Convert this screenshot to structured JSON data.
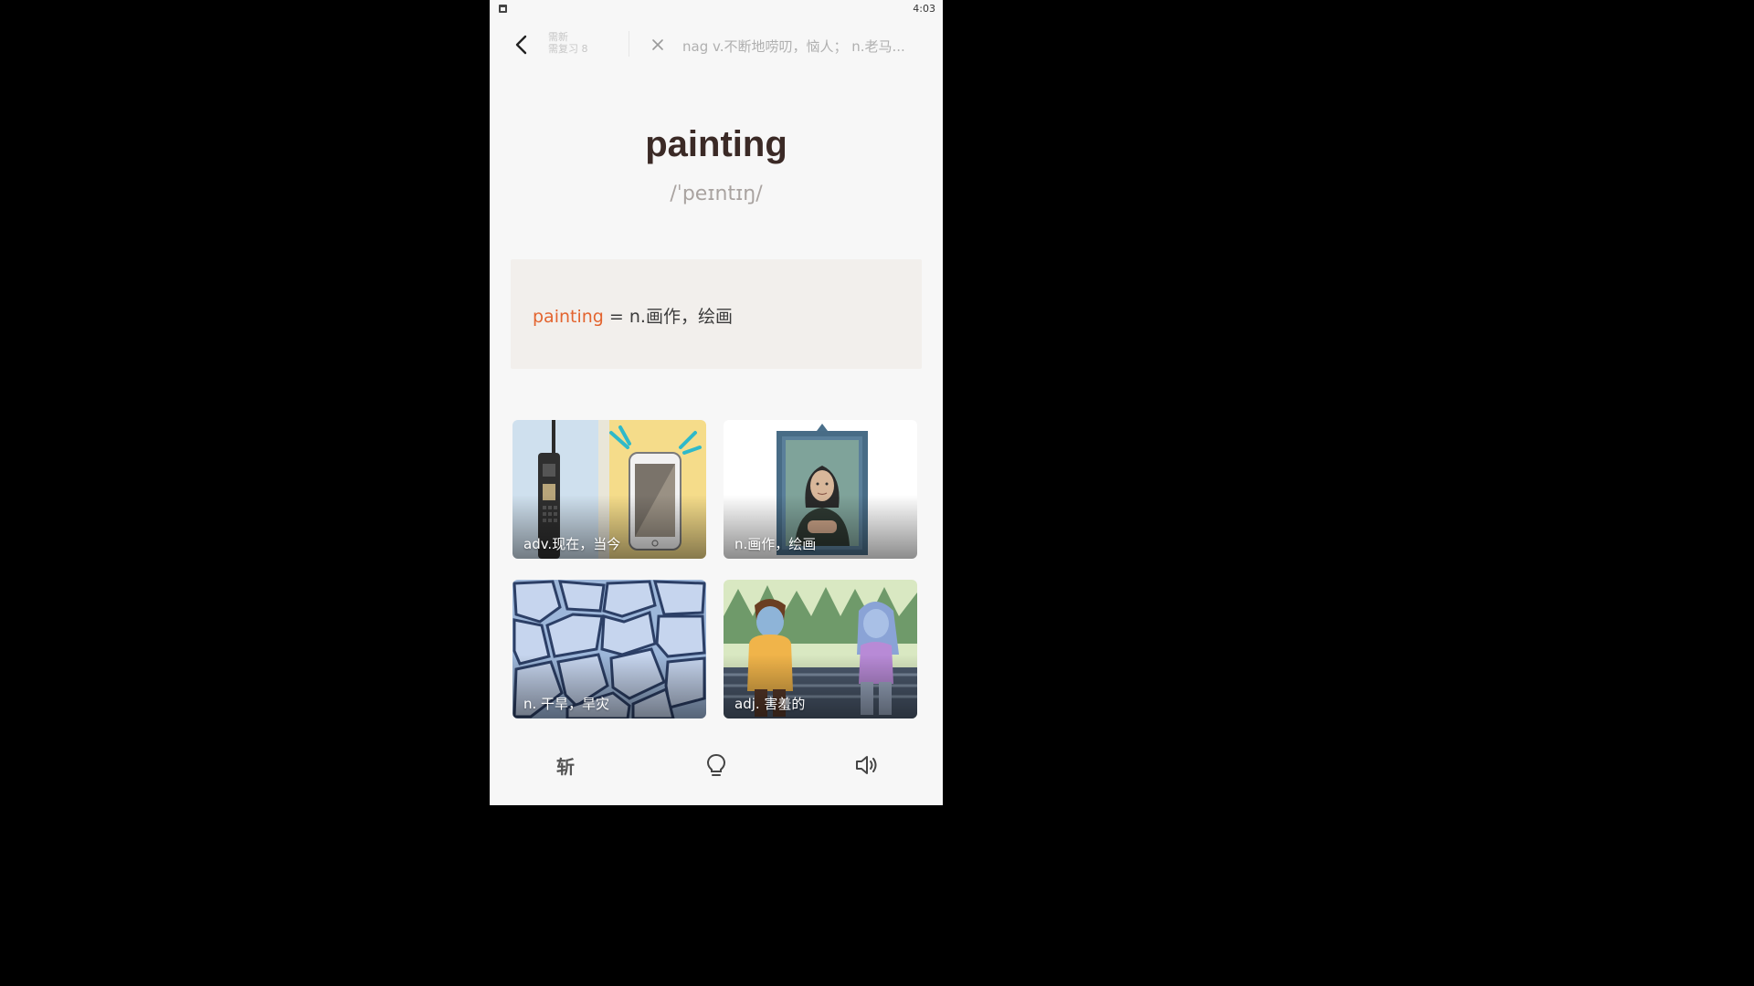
{
  "status_bar": {
    "time": "4:03"
  },
  "top_bar": {
    "counter": {
      "new_line": "需新",
      "review_line": "需复习 8"
    },
    "previous_word": "nag v.不断地唠叨，恼人； n.老马..."
  },
  "word": {
    "text": "painting",
    "phonetic": "/ˈpeɪntɪŋ/"
  },
  "definition": {
    "word": "painting",
    "meaning": " = n.画作，绘画"
  },
  "options": [
    {
      "label": "adv.现在，当今",
      "icon": "phones-image"
    },
    {
      "label": "n.画作，绘画",
      "icon": "portrait-image"
    },
    {
      "label": "n. 干旱，旱灾",
      "icon": "cracked-earth-image"
    },
    {
      "label": "adj. 害羞的",
      "icon": "shy-couple-image"
    }
  ],
  "toolbar": {
    "chop_label": "斩",
    "hint_icon": "lightbulb-icon",
    "sound_icon": "speaker-icon"
  }
}
